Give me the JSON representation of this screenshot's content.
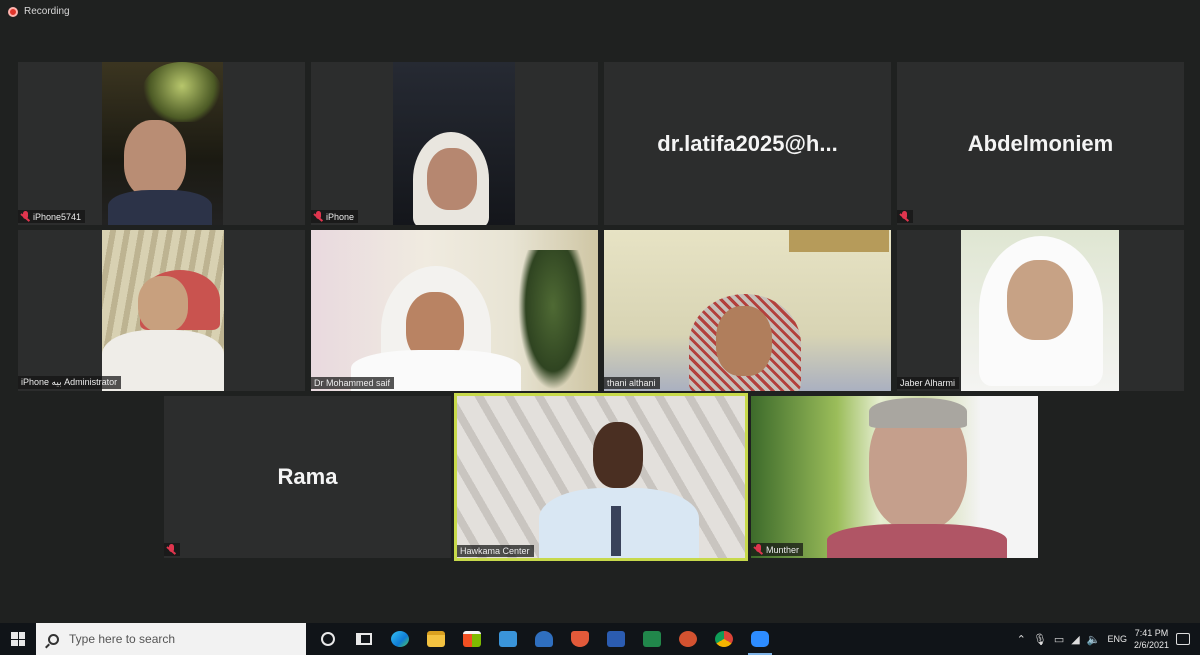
{
  "recording": {
    "label": "Recording"
  },
  "participants": [
    {
      "name": "iPhone5741"
    },
    {
      "name": "iPhone"
    },
    {
      "name": "",
      "display_name": "dr.latifa2025@h..."
    },
    {
      "name": "",
      "display_name": "Abdelmoniem"
    },
    {
      "name": "iPhone بيه Administrator"
    },
    {
      "name": "Dr Mohammed saif"
    },
    {
      "name": "thani althani"
    },
    {
      "name": "Jaber Alharmi"
    },
    {
      "name": "",
      "display_name": "Rama"
    },
    {
      "name": "Hawkama Center",
      "active_speaker": true
    },
    {
      "name": "Munther"
    }
  ],
  "taskbar": {
    "search_placeholder": "Type here to search",
    "apps": [
      "cortana-icon",
      "task-view-icon",
      "edge-icon",
      "file-explorer-icon",
      "store-icon",
      "mail-icon",
      "people-icon",
      "shield-app-icon",
      "word-icon",
      "excel-icon",
      "powerpoint-icon",
      "chrome-icon",
      "zoom-icon"
    ],
    "language": "ENG",
    "time": "7:41 PM",
    "date": "2/6/2021"
  },
  "colors": {
    "active_speaker_border": "#c7d94b",
    "tile_bg": "#2c2d2d",
    "muted_icon": "#e0354e"
  }
}
